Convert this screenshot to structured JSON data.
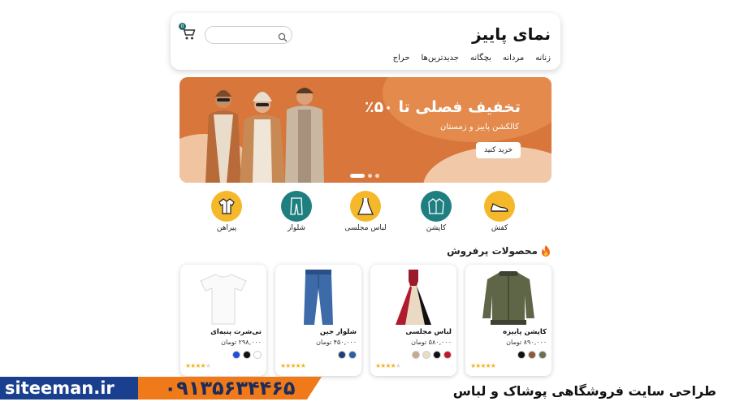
{
  "header": {
    "brand": "نمای پاییز",
    "nav": [
      "زنانه",
      "مردانه",
      "بچگانه",
      "جدیدترین‌ها",
      "حراج"
    ],
    "search_placeholder": "",
    "cart_count": "0"
  },
  "banner": {
    "title": "تخفیف فصلی تا ۵۰٪",
    "subtitle": "کالکشن پاییز و زمستان",
    "button": "خرید کنید",
    "slides": 3,
    "active_slide": 1,
    "colors": {
      "bg": "#d9763b",
      "accent": "#f2c9a8"
    }
  },
  "categories": [
    {
      "label": "کفش",
      "icon": "shoe-icon",
      "color": "#f5b82a"
    },
    {
      "label": "کاپشن",
      "icon": "jacket-icon",
      "color": "#1f7f80"
    },
    {
      "label": "لباس مجلسی",
      "icon": "dress-icon",
      "color": "#f5b82a"
    },
    {
      "label": "شلوار",
      "icon": "pants-icon",
      "color": "#1f7f80"
    },
    {
      "label": "پیراهن",
      "icon": "shirt-icon",
      "color": "#f5b82a"
    }
  ],
  "bestsellers": {
    "title": "محصولات پرفروش",
    "icon": "fire-icon",
    "products": [
      {
        "name": "کاپشن پاییزه",
        "price": "۸۹۰,۰۰۰ تومان",
        "image": "jacket-image",
        "colors": [
          "#6b6f53",
          "#8a5a3c",
          "#111111"
        ],
        "rating": 5
      },
      {
        "name": "لباس مجلسی",
        "price": "۵۸۰,۰۰۰ تومان",
        "image": "dress-image",
        "colors": [
          "#c0182a",
          "#111111",
          "#e9ddc6",
          "#c8a98c"
        ],
        "rating": 4
      },
      {
        "name": "شلوار جین",
        "price": "۴۵۰,۰۰۰ تومان",
        "image": "jeans-image",
        "colors": [
          "#2f5fa1",
          "#1c3f7a"
        ],
        "rating": 5
      },
      {
        "name": "تی‌شرت پنبه‌ای",
        "price": "۲۹۸,۰۰۰ تومان",
        "image": "tshirt-image",
        "colors": [
          "#ffffff",
          "#111111",
          "#1d4fd8"
        ],
        "rating": 4
      }
    ]
  },
  "footer": {
    "site": "siteeman.ir",
    "phone": "۰۹۱۳۵۶۳۴۴۶۵",
    "tagline": "طراحی سایت فروشگاهی پوشاک و لباس",
    "colors": {
      "blue": "#1b3f8f",
      "orange": "#f07a1a"
    }
  }
}
